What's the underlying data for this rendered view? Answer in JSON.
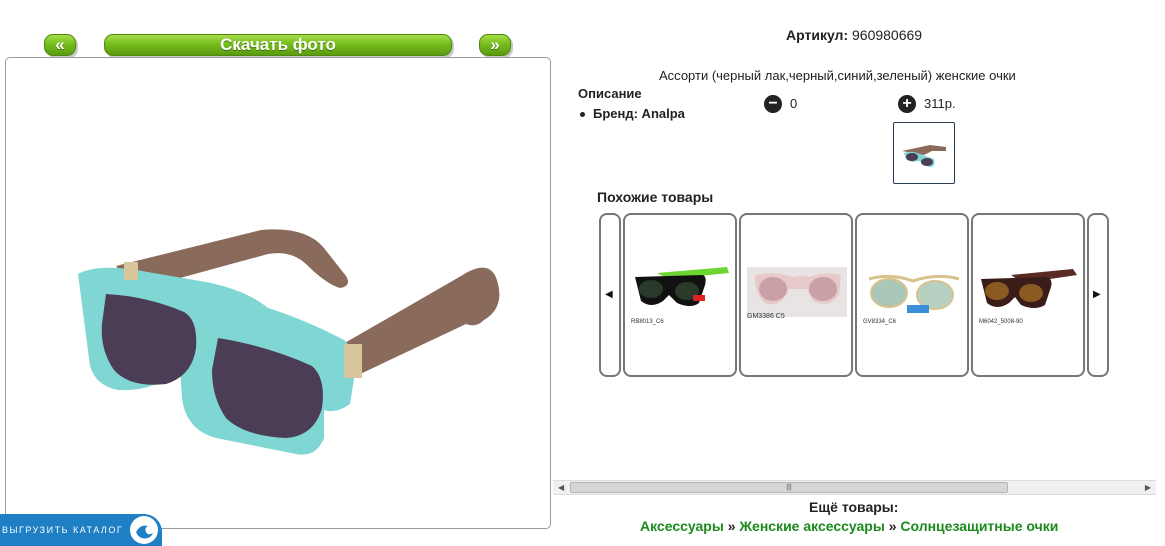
{
  "nav": {
    "prev_label": "«",
    "download_label": "Скачать фото",
    "next_label": "»"
  },
  "product": {
    "article_label": "Артикул:",
    "article_value": "960980669",
    "description": "Ассорти (черный лак,черный,синий,зеленый) женские очки",
    "desc_title": "Описание",
    "brand": "Бренд: Analpa",
    "qty": "0",
    "price": "311р."
  },
  "catalog_tab": {
    "label": "ВЫГРУЗИТЬ КАТАЛОГ"
  },
  "similar": {
    "title": "Похожие товары",
    "items": [
      {
        "code": "RB8013_C6",
        "icon": "sunglasses-green-black"
      },
      {
        "code": "GM3386 C5",
        "icon": "sunglasses-pink"
      },
      {
        "code": "GV8334_C6",
        "icon": "sunglasses-mirror"
      },
      {
        "code": "M6042_5008-90",
        "icon": "sunglasses-brown-polarized"
      }
    ]
  },
  "more": {
    "title": "Ещё товары:",
    "crumbs": [
      "Аксессуары",
      "Женские аксессуары",
      "Солнцезащитные очки"
    ],
    "separator": "»"
  },
  "colors": {
    "accent_green": "#76bd1d",
    "link_green": "#1c8a1c",
    "tab_blue": "#1f7fc4"
  }
}
